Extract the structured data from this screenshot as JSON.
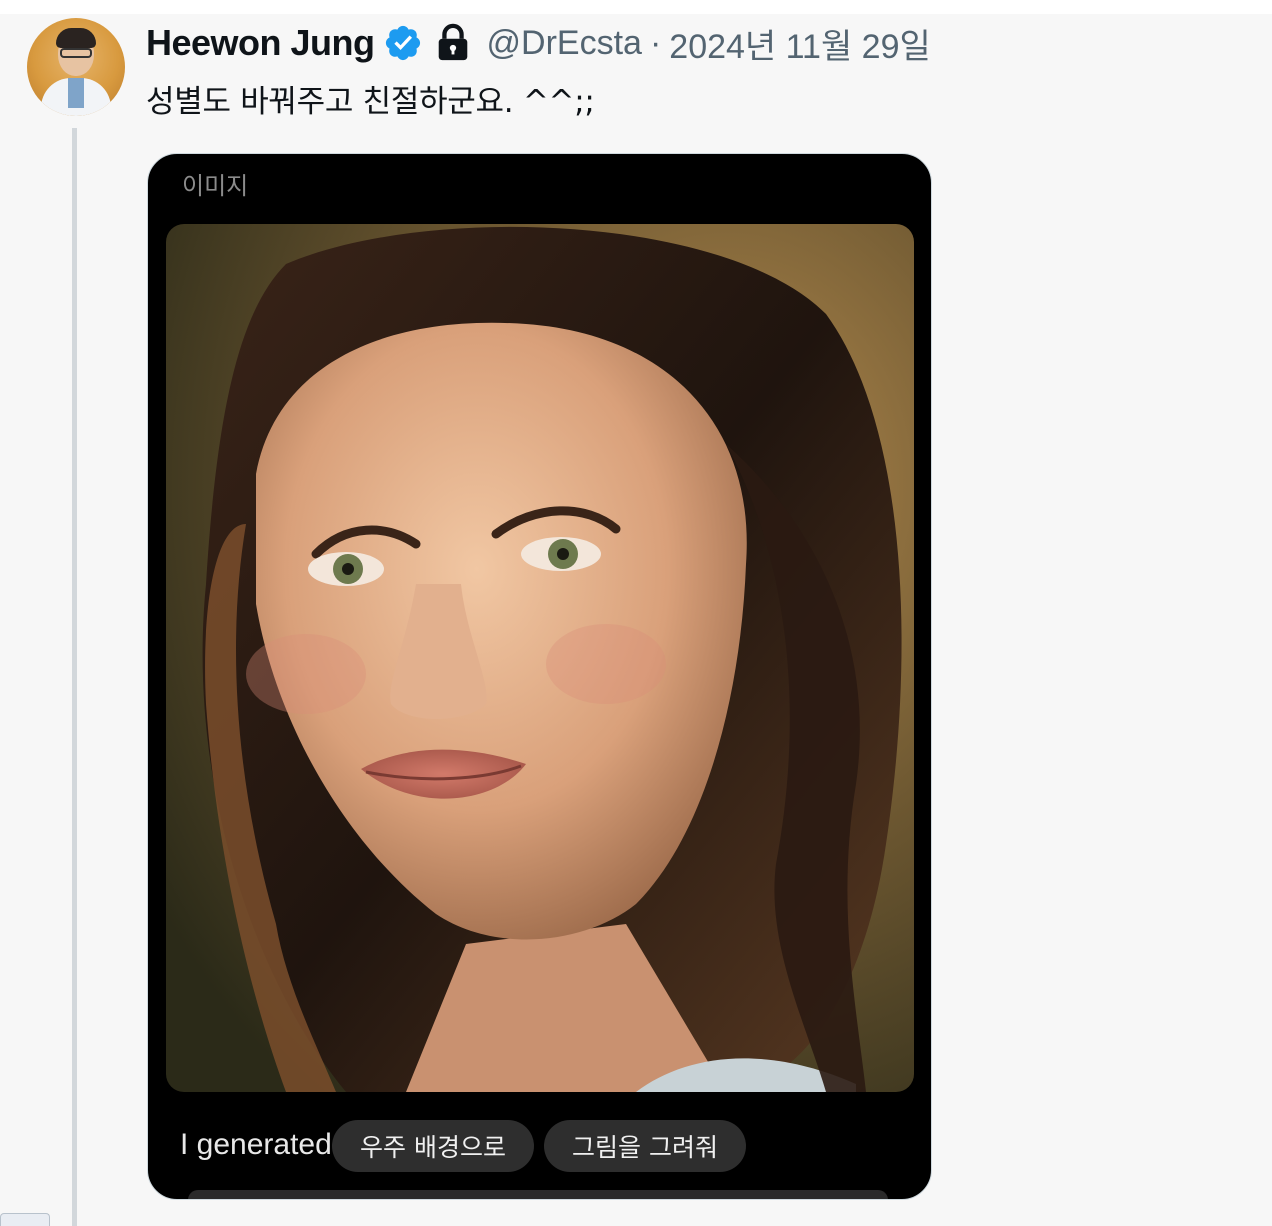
{
  "tweet": {
    "author": {
      "display_name": "Heewon Jung",
      "handle": "@DrEcsta",
      "verified_icon": "verified-badge-icon",
      "lock_icon": "lock-icon"
    },
    "separator": "·",
    "date": "2024년 11월 29일",
    "text": "성별도 바꿔주고 친절하군요. ^^;;"
  },
  "media": {
    "card_label": "이미지",
    "caption_partial": "I generated  ortrait of",
    "suggestion_chips": [
      "우주 배경으로",
      "그림을 그려줘"
    ]
  },
  "colors": {
    "text_primary": "#0f1419",
    "text_secondary": "#536471",
    "verified_blue": "#1d9bf0",
    "card_bg": "#000000",
    "chip_bg": "#2e2e2e"
  }
}
